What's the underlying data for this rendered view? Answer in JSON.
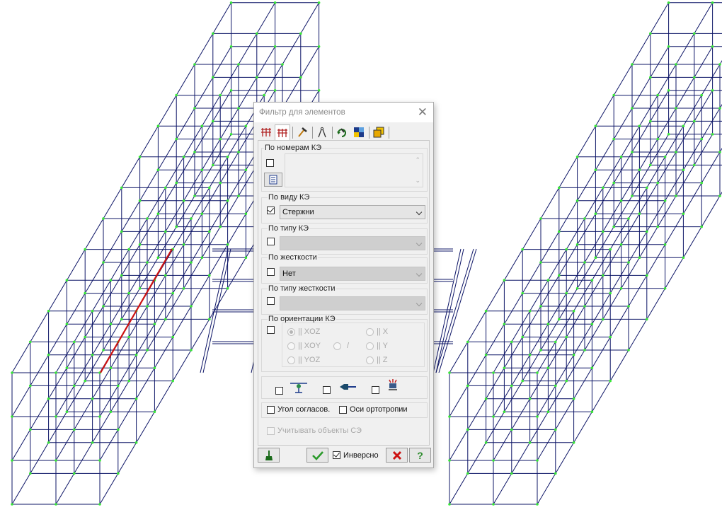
{
  "dialog": {
    "title": "Фильтр для элементов",
    "tabs": [
      {
        "name": "tab-elements-icon"
      },
      {
        "name": "tab-elements-filter-icon"
      },
      {
        "name": "tab-hammer-icon"
      },
      {
        "name": "tab-compass-icon"
      },
      {
        "name": "tab-rotate-icon"
      },
      {
        "name": "tab-color-icon"
      },
      {
        "name": "tab-layers-icon"
      }
    ],
    "by_numbers": {
      "label": "По номерам КЭ",
      "checked": false
    },
    "by_kind": {
      "label": "По виду КЭ",
      "checked": true,
      "value": "Стержни"
    },
    "by_type": {
      "label": "По типу КЭ",
      "checked": false,
      "value": ""
    },
    "by_stiffness": {
      "label": "По жесткости",
      "checked": false,
      "value": "Нет"
    },
    "by_stiffness_type": {
      "label": "По типу жесткости",
      "checked": false,
      "value": ""
    },
    "orientation": {
      "label": "По ориентации КЭ",
      "checked": false,
      "options": {
        "xoz": "|| XOZ",
        "xoy": "|| XOY",
        "yoz": "|| YOZ",
        "slash": "/",
        "x": "|| X",
        "y": "|| Y",
        "z": "|| Z"
      },
      "selected": "xoz"
    },
    "icon_filters": [
      {
        "name": "hinge-icon",
        "checked": false
      },
      {
        "name": "rigid-insert-icon",
        "checked": false
      },
      {
        "name": "support-icon",
        "checked": false
      }
    ],
    "angle_label": "Угол согласов.",
    "ortho_label": "Оси ортотропии",
    "se_objects_label": "Учитывать объекты СЭ",
    "inverse_label": "Инверсно",
    "inverse_checked": true
  },
  "colors": {
    "mesh": "#0c1466",
    "node": "#39e639",
    "highlight": "#cc1111",
    "dialog_bg": "#f0f0f0"
  }
}
